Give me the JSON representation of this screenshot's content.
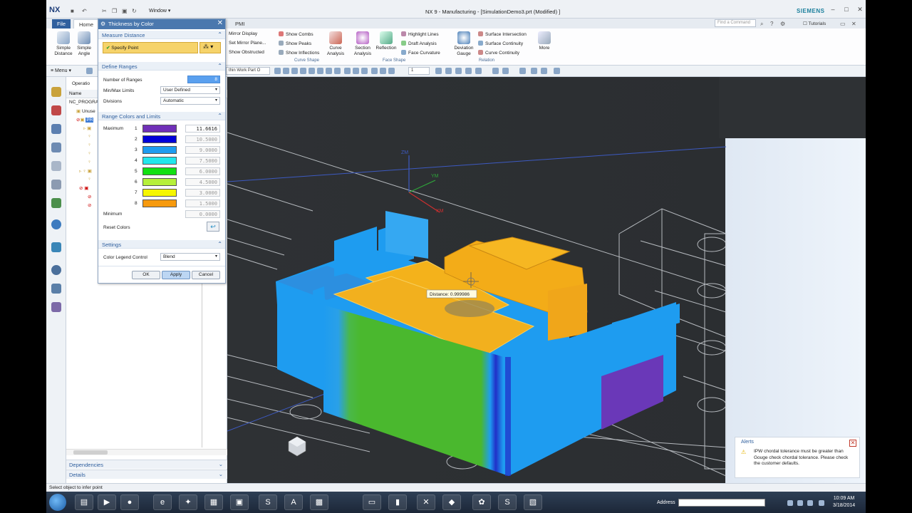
{
  "window": {
    "app_logo": "NX",
    "title": "NX 9 - Manufacturing - [SimulationDemo3.prt (Modified) ]",
    "brand": "SIEMENS",
    "window_menu": "Window"
  },
  "ribbon_tabs": {
    "file": "File",
    "home": "Home",
    "pmi": "PMI",
    "find_placeholder": "Find a Command",
    "tutorials": "Tutorials"
  },
  "ribbon": {
    "simple_distance": "Simple Distance",
    "simple_angle": "Simple Angle",
    "mirror_display": "Mirror Display",
    "set_mirror_plane": "Set Mirror Plane...",
    "show_obstructed": "Show Obstructed",
    "show_combs": "Show Combs",
    "show_peaks": "Show Peaks",
    "show_inflections": "Show Inflections",
    "curve_analysis": "Curve Analysis",
    "curve_shape_group": "Curve Shape",
    "section_analysis": "Section Analysis",
    "reflection": "Reflection",
    "highlight_lines": "Highlight Lines",
    "draft_analysis": "Draft Analysis",
    "face_curvature": "Face Curvature",
    "face_shape_group": "Face Shape",
    "deviation_gauge": "Deviation Gauge",
    "surface_intersection": "Surface Intersection",
    "surface_continuity": "Surface Continuity",
    "curve_continuity": "Curve Continuity",
    "relation_group": "Relation",
    "more": "More"
  },
  "command_bar": {
    "menu": "Menu",
    "filter_select": "thin Work Part O",
    "level_select": "1"
  },
  "navigator": {
    "header": "Operatio",
    "column_name": "Name",
    "rows": [
      "NC_PROGRA",
      "Unuse",
      "PR"
    ],
    "dependencies": "Dependencies",
    "details": "Details"
  },
  "dialog": {
    "title": "Thickness by Color",
    "measure_distance": "Measure Distance",
    "specify_point": "Specify Point",
    "define_ranges": "Define Ranges",
    "number_of_ranges_label": "Number of Ranges",
    "number_of_ranges_value": "8",
    "min_max_label": "Min/Max Limits",
    "min_max_value": "User Defined",
    "divisions_label": "Divisions",
    "divisions_value": "Automatic",
    "range_colors": "Range Colors and Limits",
    "maximum_label": "Maximum",
    "minimum_label": "Minimum",
    "minimum_value": "0.0000",
    "reset_colors": "Reset Colors",
    "ranges": [
      {
        "index": "1",
        "color": "#7030b8",
        "value": "11.6616"
      },
      {
        "index": "2",
        "color": "#0000d8",
        "value": "10.5000"
      },
      {
        "index": "3",
        "color": "#1e9cf0",
        "value": "9.0000"
      },
      {
        "index": "4",
        "color": "#22e6ec",
        "value": "7.5000"
      },
      {
        "index": "5",
        "color": "#12e012",
        "value": "6.0000"
      },
      {
        "index": "6",
        "color": "#b6f03a",
        "value": "4.5000"
      },
      {
        "index": "7",
        "color": "#f6f600",
        "value": "3.0000"
      },
      {
        "index": "8",
        "color": "#f79a0e",
        "value": "1.5000"
      }
    ],
    "settings": "Settings",
    "legend_label": "Color Legend Control",
    "legend_value": "Blend",
    "ok": "OK",
    "apply": "Apply",
    "cancel": "Cancel"
  },
  "viewport": {
    "distance_label": "Distance: 0.999986",
    "axis_zm": "ZM",
    "axis_ym": "YM",
    "axis_xm": "XM"
  },
  "alerts": {
    "title": "Alerts",
    "message": "IPW chordal tolerance must be greater than Gouge check chordal tolerance. Please check the customer defaults."
  },
  "status": "Select object to infer point",
  "taskbar": {
    "address_label": "Address",
    "time": "10:09 AM",
    "date": "3/18/2014"
  }
}
